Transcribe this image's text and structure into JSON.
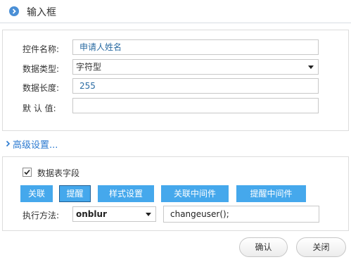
{
  "dialog": {
    "title": "输入框"
  },
  "form": {
    "control_name": {
      "label": "控件名称:",
      "value": "申请人姓名"
    },
    "data_type": {
      "label": "数据类型:",
      "value": "字符型"
    },
    "data_length": {
      "label": "数据长度:",
      "value": "255"
    },
    "default_value": {
      "label": "默 认 值:",
      "value": ""
    }
  },
  "advanced": {
    "toggle_label": "高级设置...",
    "table_field": {
      "label": "数据表字段",
      "checked": true
    },
    "buttons": [
      {
        "label": "关联"
      },
      {
        "label": "提醒"
      },
      {
        "label": "样式设置"
      },
      {
        "label": "关联中间件"
      },
      {
        "label": "提醒中间件"
      }
    ],
    "exec_method": {
      "label": "执行方法:",
      "event": "onblur",
      "handler": "changeuser();"
    }
  },
  "footer": {
    "confirm_label": "确认",
    "close_label": "关闭"
  },
  "colors": {
    "accent": "#45a8ec",
    "link": "#2b7ad1",
    "title_icon": "#4a8fd6"
  }
}
